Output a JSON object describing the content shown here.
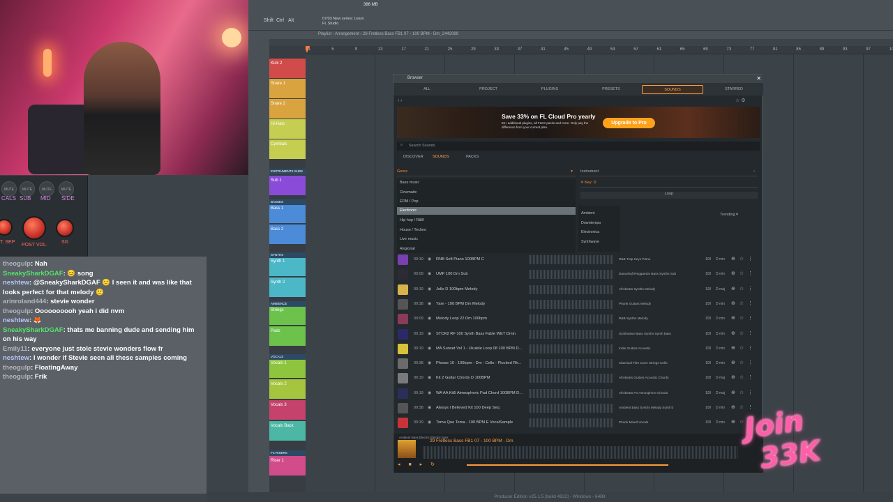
{
  "colors": {
    "accent": "#ff9b3d",
    "chat_bg": "#5a6066",
    "browser_bg": "#24292d",
    "stream_overlay": "#ff5fa8"
  },
  "toolbar": {
    "buttons": [
      "Shift",
      "Ctrl",
      "Alt"
    ],
    "memory": "386 MB",
    "hint": {
      "line1": "07/03 New series: Learn",
      "line2": "FL Studio"
    }
  },
  "playlist": {
    "title": "Playlist - Arrangement › 28 Fretless Bass FB1 07 - 100 BPM - Dm_2442089",
    "ruler_ticks": [
      "1",
      "5",
      "9",
      "13",
      "17",
      "21",
      "25",
      "29",
      "33",
      "37",
      "41",
      "45",
      "49",
      "53",
      "57",
      "61",
      "65",
      "69",
      "73",
      "77",
      "81",
      "85",
      "89",
      "93",
      "97",
      "101"
    ]
  },
  "tracks": [
    {
      "label": "Kick 2",
      "color": "#d24b4b"
    },
    {
      "label": "Snare 1",
      "color": "#d9a33f"
    },
    {
      "label": "Snare 2",
      "color": "#d9a33f"
    },
    {
      "label": "Hi-Hats",
      "color": "#c6ce52"
    },
    {
      "label": "Cymbals",
      "color": "#c6ce52"
    },
    {
      "label": "Sub 1",
      "color": "#8a4bd8"
    },
    {
      "label": "Bass 1",
      "color": "#4b8bd8"
    },
    {
      "label": "Bass 2",
      "color": "#4b8bd8"
    },
    {
      "label": "Synth 1",
      "color": "#4bb7c7"
    },
    {
      "label": "Synth 2",
      "color": "#4bb7c7"
    },
    {
      "label": "Strings",
      "color": "#6cc24b"
    },
    {
      "label": "Pads",
      "color": "#6cc24b"
    },
    {
      "label": "Vocals 1",
      "color": "#8ec53f"
    },
    {
      "label": "Vocals 2",
      "color": "#a5c53f"
    },
    {
      "label": "Vocals 3",
      "color": "#c5426d"
    },
    {
      "label": "Vocals Back",
      "color": "#4bb7a4"
    },
    {
      "label": "Riser 1",
      "color": "#d24b8a"
    }
  ],
  "track_groups": [
    "INSTRUMENTS SUBS",
    "BASSES",
    "SYNTHS",
    "AMBIENCE",
    "VOCALS",
    "FX RISERS"
  ],
  "mixer": {
    "channels": [
      "CALS",
      "SUB",
      "MID",
      "SIDE"
    ],
    "mute": "MUTE",
    "knobs": [
      "T. SEP",
      "POST VOL.",
      "SG"
    ]
  },
  "chat": [
    {
      "name": "theogulp",
      "msg": ": Nah",
      "cls": "grey"
    },
    {
      "name": "SneakySharkDGAF",
      "msg": ": 😊 song",
      "cls": "green"
    },
    {
      "name": "neshtew",
      "msg": ": @SneakySharkDGAF 🙂 I seen it and was like that looks perfect for that melody 🙂",
      "cls": "blue"
    },
    {
      "name": "arinroland444",
      "msg": ": stevie wonder",
      "cls": "grey"
    },
    {
      "name": "theogulp",
      "msg": ": Oooooooooh yeah i did nvm",
      "cls": "grey"
    },
    {
      "name": "neshtew",
      "msg": ": 🦊",
      "cls": "blue"
    },
    {
      "name": "SneakySharkDGAF",
      "msg": ": thats me banning dude and sending him on his way",
      "cls": "green"
    },
    {
      "name": "Emily11",
      "msg": ": everyone just stole stevie wonders flow fr",
      "cls": "grey"
    },
    {
      "name": "neshtew",
      "msg": ": I wonder if Stevie seen all these samples coming",
      "cls": "blue"
    },
    {
      "name": "theogulp",
      "msg": ": FloatingAway",
      "cls": "grey"
    },
    {
      "name": "theogulp",
      "msg": ": Frik",
      "cls": "grey"
    }
  ],
  "browser": {
    "title": "Browser",
    "tabs": [
      "ALL",
      "PROJECT",
      "PLUGINS",
      "PRESETS",
      "SOUNDS",
      "STARRED"
    ],
    "active_tab": "SOUNDS",
    "banner": {
      "title": "Save 33% on FL Cloud Pro yearly",
      "sub": "55+ additional plugins, all FLEX packs and more. Only pay the difference from your current plan.",
      "button": "Upgrade to Pro"
    },
    "search_placeholder": "Search Sounds",
    "subtabs": [
      "DISCOVER",
      "SOUNDS",
      "PACKS"
    ],
    "active_subtab": "SOUNDS",
    "genre_label": "Genre",
    "instrument_label": "Instrument",
    "key_label": "Key: D",
    "loop_label": "Loop",
    "genres": [
      "Bass music",
      "Cinematic",
      "EDM / Pop",
      "Electronic",
      "Hip hop / R&B",
      "House / Techno",
      "Live music",
      "Regional"
    ],
    "selected_genre": "Electronic",
    "subgenres": [
      "Ambient",
      "Downtempo",
      "Electronica",
      "Synthwave"
    ],
    "trending": "Trending",
    "samples": [
      {
        "time": "00:19",
        "name": "RNB Soft Piano 100BPM C",
        "tags": "R&B  Trap  Keys  Piano",
        "bpm": "100",
        "key": "D min",
        "thumb": "#7a3fb0"
      },
      {
        "time": "00:09",
        "name": "UMF 100 Dm Sub",
        "tags": "Dancehall  Reggaeton  Bass  Synths  Sub",
        "bpm": "100",
        "key": "D min",
        "thumb": "#2b2b35"
      },
      {
        "time": "00:19",
        "name": "Jollo D 100bpm Melody",
        "tags": "Afrobeats  Synths  Melody",
        "bpm": "100",
        "key": "D maj",
        "thumb": "#d8b24a"
      },
      {
        "time": "00:38",
        "name": "Yare - 100 BPM Dm Melody",
        "tags": "Phonk  Guitars  Melody",
        "bpm": "100",
        "key": "D min",
        "thumb": "#555"
      },
      {
        "time": "00:09",
        "name": "Melody Loop 22 Dm 100bpm",
        "tags": "R&B  Synths  Melody",
        "bpm": "100",
        "key": "D min",
        "thumb": "#8a3b5a"
      },
      {
        "time": "00:19",
        "name": "STCR2 RF 100 Synth Bass Fable WET Dmin",
        "tags": "Synthwave  Bass  Synths  Synth bass",
        "bpm": "100",
        "key": "D min",
        "thumb": "#2a2a6a"
      },
      {
        "time": "00:19",
        "name": "MA Sunset Vol 1 - Ukulele Loop 08 100 BPM D...",
        "tags": "Indie  Guitars  Acoustic",
        "bpm": "100",
        "key": "D min",
        "thumb": "#d7c23a"
      },
      {
        "time": "00:38",
        "name": "Phrase 10 - 100bpm - Dm - Cello - Plucked Rh...",
        "tags": "Classical  Film score  Strings  Cello",
        "bpm": "100",
        "key": "D min",
        "thumb": "#6b6b6b"
      },
      {
        "time": "00:19",
        "name": "Kit 2 Guitar Chords D 100BPM",
        "tags": "Afrobeats  Guitars  Acoustic  Chords",
        "bpm": "100",
        "key": "D maj",
        "thumb": "#7a7a7a"
      },
      {
        "time": "00:19",
        "name": "WA AA Kit5 Atmospheric Pad Chord 100BPM D...",
        "tags": "Afrobeats  FX  Atmosphere  Chords",
        "bpm": "100",
        "key": "D maj",
        "thumb": "#2a2f5a"
      },
      {
        "time": "00:38",
        "name": "Always I Believed Kit 100 Deep Seq",
        "tags": "Ambient  Bass  Synths  Melody  Synth b",
        "bpm": "100",
        "key": "D min",
        "thumb": "#555"
      },
      {
        "time": "00:19",
        "name": "Toma Que Toma - 100 BPM E VocalSample",
        "tags": "Phonk  Mixed  Vocals",
        "bpm": "100",
        "key": "D min",
        "thumb": "#c8333a"
      }
    ],
    "player": {
      "tags": "Ambient   Bass   Electric   Electric bass",
      "title": "29 Fretless Bass FB1 07 - 100 BPM - Dm",
      "progress": 0.99
    }
  },
  "statusbar": "Producer Edition v25.1.5 [build 4922] - Windows - 64Bit",
  "overlay": {
    "line1": "Join",
    "line2": "33K"
  }
}
